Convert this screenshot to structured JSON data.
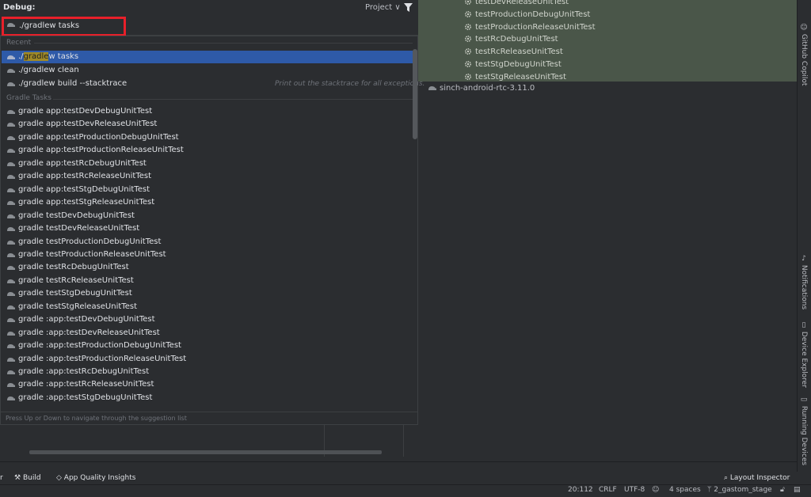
{
  "header": {
    "title": "Debug:",
    "project_select": "Project ∨"
  },
  "search": {
    "value": "./gradlew tasks"
  },
  "popup": {
    "recent_label": "Recent",
    "recent": [
      {
        "pre": "./",
        "hl": "gradle",
        "post": "w tasks"
      },
      {
        "text": "./gradlew clean"
      },
      {
        "text": "./gradlew build --stacktrace",
        "hint": "Print out the stacktrace for all exceptions."
      }
    ],
    "tasks_label": "Gradle Tasks",
    "tasks": [
      "gradle app:testDevDebugUnitTest",
      "gradle app:testDevReleaseUnitTest",
      "gradle app:testProductionDebugUnitTest",
      "gradle app:testProductionReleaseUnitTest",
      "gradle app:testRcDebugUnitTest",
      "gradle app:testRcReleaseUnitTest",
      "gradle app:testStgDebugUnitTest",
      "gradle app:testStgReleaseUnitTest",
      "gradle testDevDebugUnitTest",
      "gradle testDevReleaseUnitTest",
      "gradle testProductionDebugUnitTest",
      "gradle testProductionReleaseUnitTest",
      "gradle testRcDebugUnitTest",
      "gradle testRcReleaseUnitTest",
      "gradle testStgDebugUnitTest",
      "gradle testStgReleaseUnitTest",
      "gradle :app:testDevDebugUnitTest",
      "gradle :app:testDevReleaseUnitTest",
      "gradle :app:testProductionDebugUnitTest",
      "gradle :app:testProductionReleaseUnitTest",
      "gradle :app:testRcDebugUnitTest",
      "gradle :app:testRcReleaseUnitTest",
      "gradle :app:testStgDebugUnitTest"
    ],
    "footer": "Press Up or Down to navigate through the suggestion list"
  },
  "right_tree": {
    "items": [
      "testDevReleaseUnitTest",
      "testProductionDebugUnitTest",
      "testProductionReleaseUnitTest",
      "testRcDebugUnitTest",
      "testRcReleaseUnitTest",
      "testStgDebugUnitTest",
      "testStgReleaseUnitTest"
    ],
    "sinch": "sinch-android-rtc-3.11.0"
  },
  "side_strip": {
    "copilot": "GitHub Copilot",
    "notifications": "Notifications",
    "device_explorer": "Device Explorer",
    "running_devices": "Running Devices"
  },
  "toolbar": {
    "left_fragment": "r",
    "build": "Build",
    "app_quality": "App Quality Insights",
    "layout_inspector": "Layout Inspector"
  },
  "status": {
    "position": "20:112",
    "line_sep": "CRLF",
    "encoding": "UTF-8",
    "indent": "4 spaces",
    "branch": "2_gastom_stage"
  },
  "colors": {
    "selection": "#2e5aa8",
    "highlight_box": "#e8202a",
    "tree_bg": "#4a5649"
  }
}
